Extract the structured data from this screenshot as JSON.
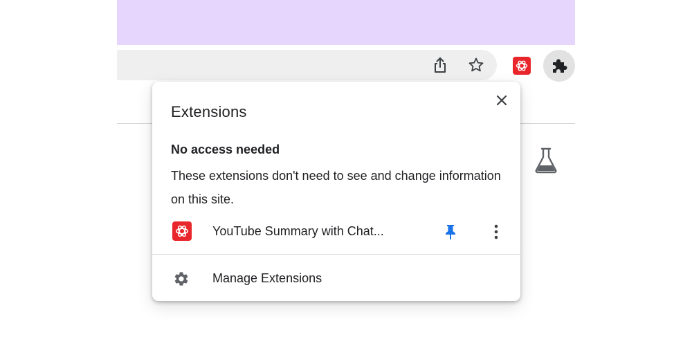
{
  "colors": {
    "tab_strip": "#e6d5fc",
    "omnibox": "#efefef",
    "extension_brand": "#e8262b",
    "pin_accent": "#1a73e8"
  },
  "toolbar": {
    "share_icon": "share-icon",
    "bookmark_icon": "star-icon",
    "extension_icon": "openai-logo-icon",
    "extensions_menu_icon": "puzzle-piece-icon"
  },
  "popup": {
    "title": "Extensions",
    "close_icon": "close-icon",
    "section_heading": "No access needed",
    "section_description": "These extensions don't need to see and change information on this site.",
    "extensions": [
      {
        "name": "YouTube Summary with Chat...",
        "icon": "openai-logo-icon",
        "pinned": true
      }
    ],
    "manage_label": "Manage Extensions",
    "manage_icon": "gear-icon"
  },
  "page": {
    "labs_icon": "flask-icon"
  }
}
